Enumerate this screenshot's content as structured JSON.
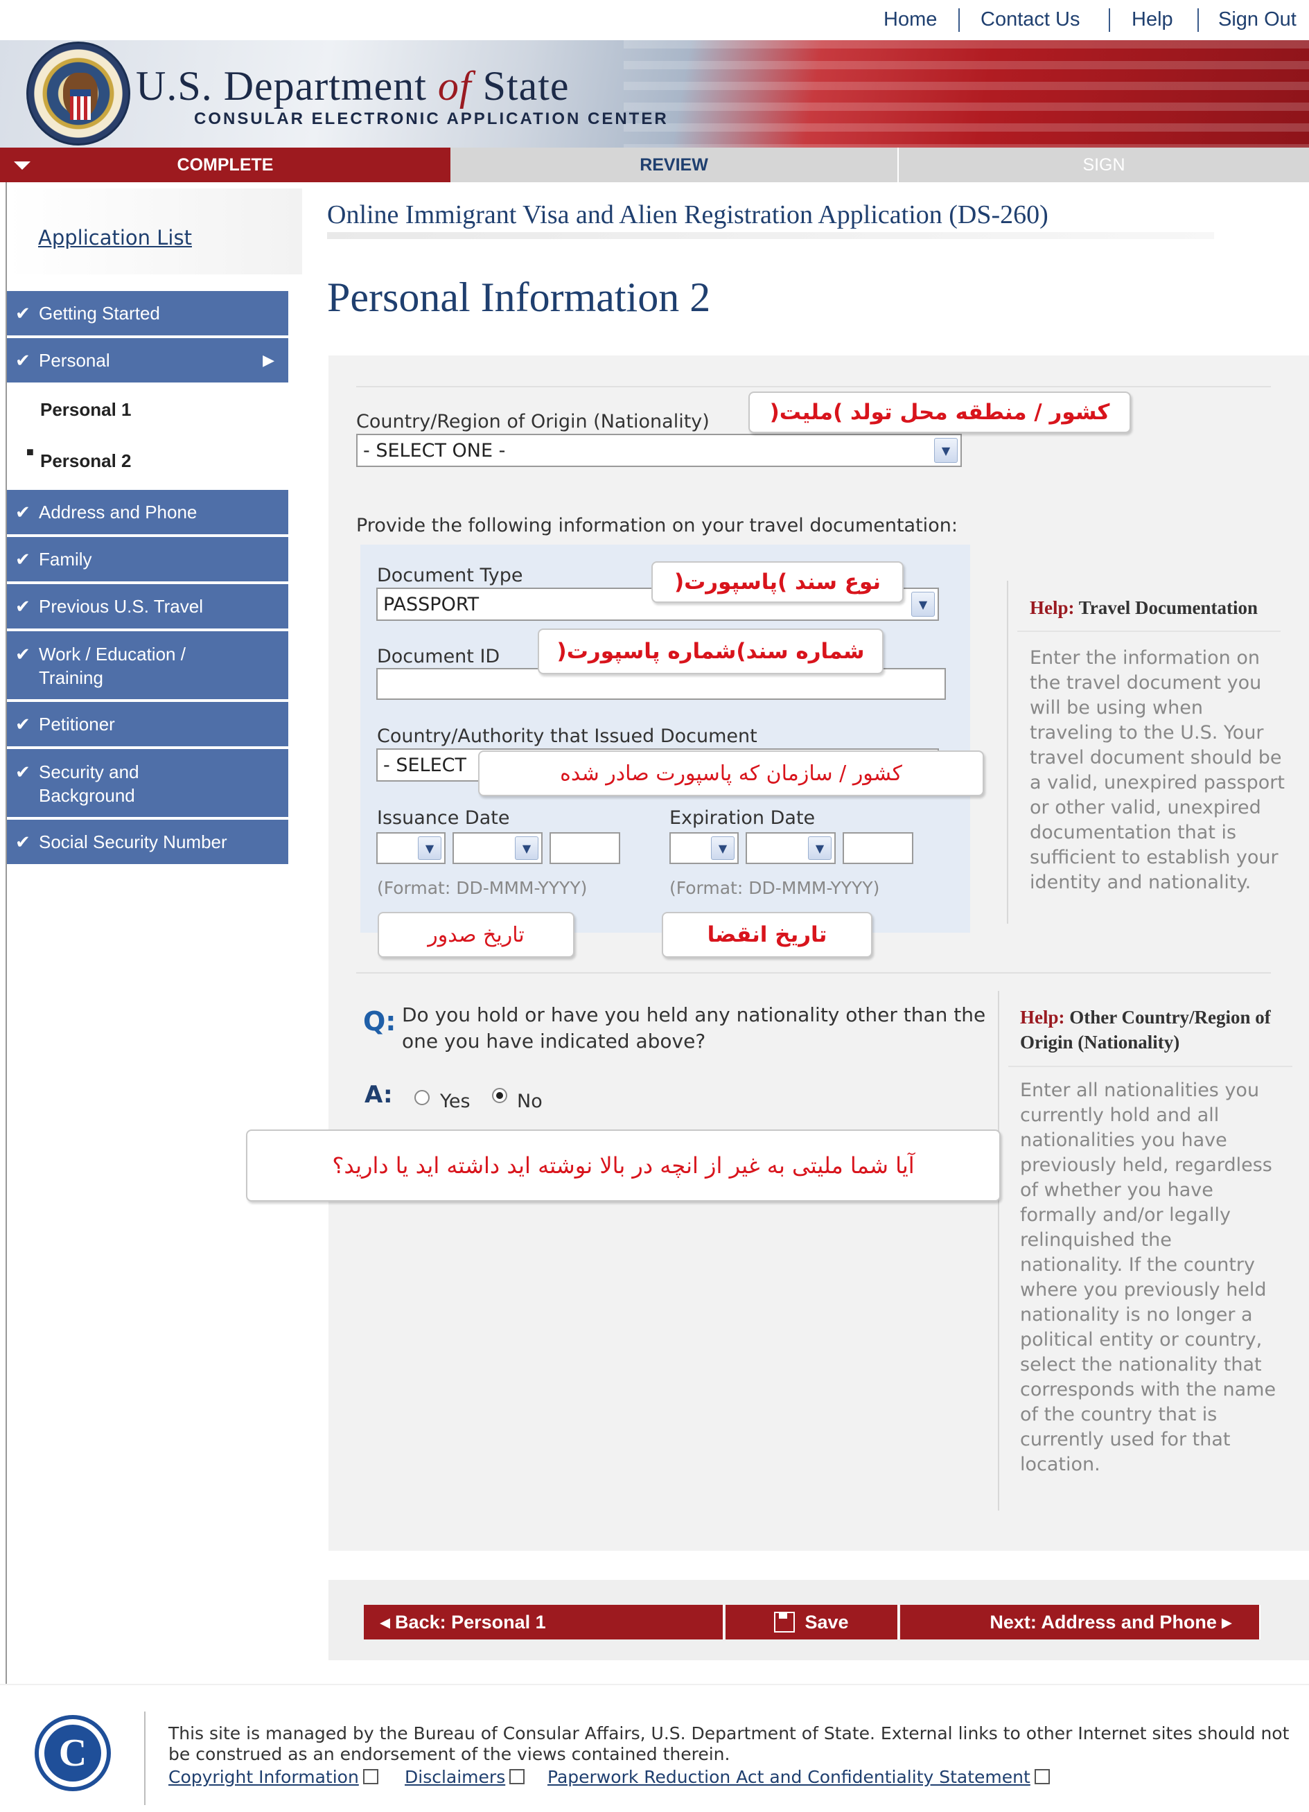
{
  "toplinks": [
    "Home",
    "Contact Us",
    "Help",
    "Sign Out"
  ],
  "banner": {
    "title_a": "U.S. Department ",
    "title_of": "of",
    "title_b": " State",
    "subtitle": "CONSULAR ELECTRONIC APPLICATION CENTER"
  },
  "steps": {
    "complete": "COMPLETE",
    "review": "REVIEW",
    "sign": "SIGN"
  },
  "sidebar": {
    "application_list": "Application List",
    "items": [
      "Getting Started",
      "Personal",
      "Address and Phone",
      "Family",
      "Previous U.S. Travel",
      "Work / Education / Training",
      "Petitioner",
      "Security and Background",
      "Social Security Number"
    ],
    "subitems": [
      "Personal 1",
      "Personal 2"
    ]
  },
  "form": {
    "title": "Online Immigrant Visa and Alien Registration Application (DS-260)",
    "page_title": "Personal Information 2",
    "nationality_label": "Country/Region of Origin (Nationality)",
    "nationality_value": "- SELECT ONE -",
    "travel_doc_intro": "Provide the following information on your travel documentation:",
    "doc_type_label": "Document Type",
    "doc_type_value": "PASSPORT",
    "doc_id_label": "Document ID",
    "doc_id_value": "",
    "country_issued_label": "Country/Authority that Issued Document",
    "country_issued_value": "- SELECT",
    "issuance_label": "Issuance Date",
    "expiration_label": "Expiration Date",
    "date_format": "(Format: DD-MMM-YYYY)",
    "question": "Do you hold or have you held any nationality other than the one you have indicated above?",
    "q": "Q:",
    "a": "A:",
    "yes": "Yes",
    "no": "No"
  },
  "help": {
    "travel_title_prefix": "Help:",
    "travel_title": " Travel Documentation",
    "travel_text": "Enter the information on the travel document you will be using when traveling to the U.S. Your travel document should be a valid, unexpired passport or other valid, unexpired documentation that is sufficient to establish your identity and nationality.",
    "other_title_prefix": "Help:",
    "other_title": " Other Country/Region of Origin (Nationality)",
    "other_text": "Enter all nationalities you currently hold and all nationalities you have previously held, regardless of whether you have formally and/or legally relinquished the nationality. If the country where you previously held nationality is no longer a political entity or country, select the nationality that corresponds with the name of the country that is currently used for that location."
  },
  "callouts": {
    "nationality": "کشور / منطقه محل تولد )ملیت(",
    "doc_type": "نوع سند )پاسپورت(",
    "doc_id": "شماره سند)شماره پاسپورت(",
    "country_issued": "کشور / سازمان که پاسپورت صادر شده",
    "issuance": "تاریخ صدور",
    "expiration": "تاریخ انقضا",
    "question": "آیا شما ملیتی به غیر از انچه در بالا نوشته اید داشته اید یا دارید؟"
  },
  "buttons": {
    "back": "◂ Back: Personal 1",
    "save": "Save",
    "next": "Next: Address and Phone ▸"
  },
  "footer": {
    "text": "This site is managed by the Bureau of Consular Affairs, U.S. Department of State. External links to other Internet sites should not be construed as an endorsement of the views contained therein.",
    "links": [
      "Copyright Information",
      "Disclaimers",
      "Paperwork Reduction Act and Confidentiality Statement"
    ],
    "logo_letter": "C"
  }
}
